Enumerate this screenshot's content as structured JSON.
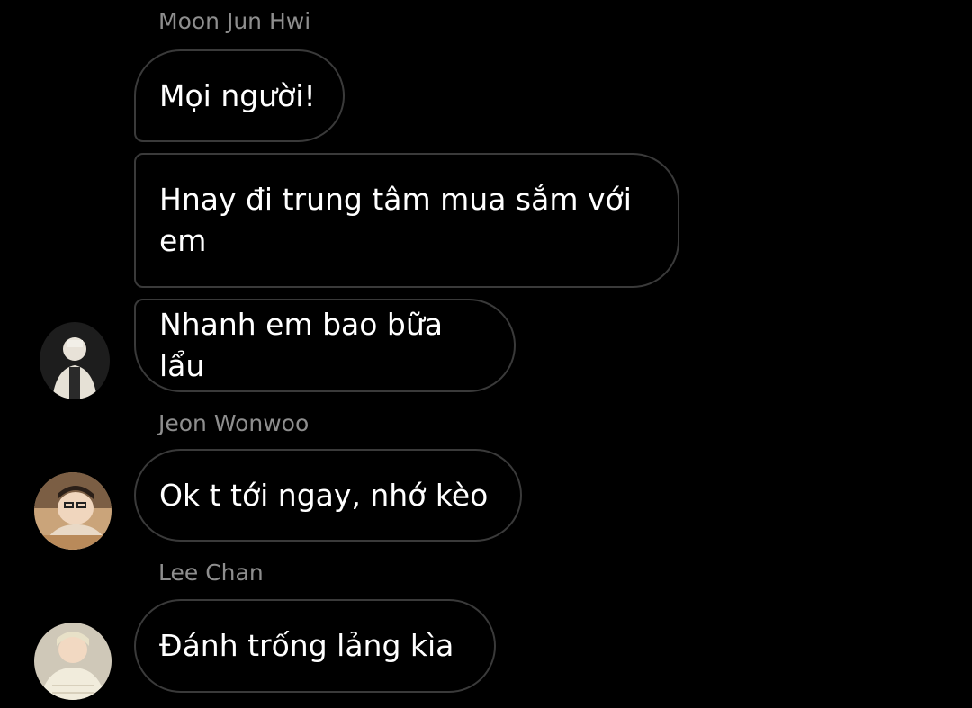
{
  "groups": [
    {
      "sender": "Moon Jun Hwi",
      "messages": [
        "Mọi người!",
        "Hnay đi trung tâm mua sắm với em",
        "Nhanh em bao bữa lẩu"
      ]
    },
    {
      "sender": "Jeon Wonwoo",
      "messages": [
        "Ok t tới ngay, nhớ kèo"
      ]
    },
    {
      "sender": "Lee Chan",
      "messages": [
        "Đánh trống lảng kìa"
      ]
    }
  ],
  "colors": {
    "background": "#000000",
    "bubble_border": "#3a3a3a",
    "message_text": "#ffffff",
    "sender_name": "#8e8e8e"
  }
}
